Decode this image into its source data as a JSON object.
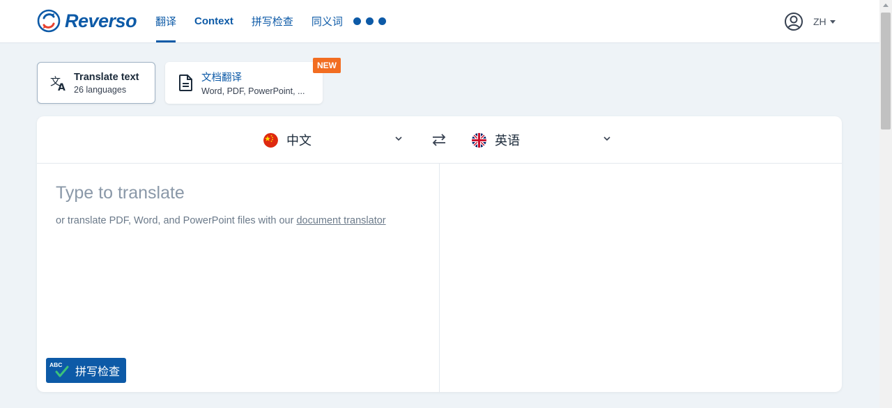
{
  "header": {
    "logo_text": "Reverso",
    "nav": [
      {
        "label": "翻译",
        "active": true
      },
      {
        "label": "Context",
        "active": false
      },
      {
        "label": "拼写检查",
        "active": false
      },
      {
        "label": "同义词",
        "active": false
      }
    ],
    "user_lang": "ZH"
  },
  "modes": {
    "translate_text": {
      "title": "Translate text",
      "subtitle": "26 languages"
    },
    "document": {
      "title": "文档翻译",
      "subtitle": "Word, PDF, PowerPoint, ...",
      "badge": "NEW"
    }
  },
  "translator": {
    "source_lang": "中文",
    "target_lang": "英语",
    "placeholder": "Type to translate",
    "hint_prefix": "or translate PDF, Word, and PowerPoint files with our ",
    "hint_link": "document translator",
    "spellcheck_label": "拼写检查",
    "spellcheck_abc": "ABC"
  },
  "colors": {
    "brand": "#0d5aa7",
    "badge": "#f26d21",
    "background": "#eef3f7"
  },
  "icons": [
    "reverso-logo-icon",
    "user-icon",
    "translate-icon",
    "document-icon",
    "china-flag-icon",
    "uk-flag-icon",
    "swap-icon",
    "chevron-down-icon",
    "spellcheck-icon"
  ]
}
